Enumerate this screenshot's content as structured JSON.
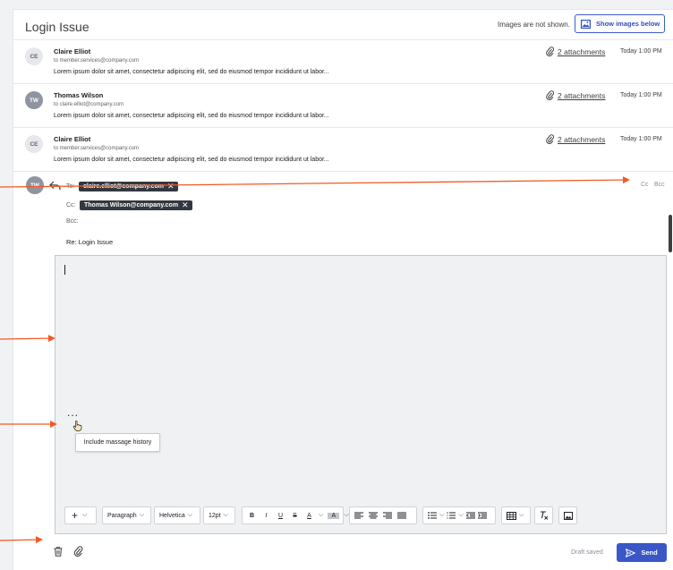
{
  "header": {
    "title": "Login Issue",
    "images_notice": "Images are not shown.",
    "show_images_button": "Show images below"
  },
  "messages": [
    {
      "initials": "CE",
      "sender": "Claire Elliot",
      "to": "to member.services@company.com",
      "preview": "Lorem ipsum dolor sit amet, consectetur adipiscing elit, sed do eiusmod tempor incididunt ut labor...",
      "attachments": "2 attachments",
      "time": "Today 1:00 PM",
      "avatar_style": "light"
    },
    {
      "initials": "TW",
      "sender": "Thomas Wilson",
      "to": "to claire.elliot@company.com",
      "preview": "Lorem ipsum dolor sit amet, consectetur adipiscing elit, sed do eiusmod tempor incididunt ut labor...",
      "attachments": "2 attachments",
      "time": "Today 1:00 PM",
      "avatar_style": "dark"
    },
    {
      "initials": "CE",
      "sender": "Claire Elliot",
      "to": "to member.services@company.com",
      "preview": "Lorem ipsum dolor sit amet, consectetur adipiscing elit, sed do eiusmod tempor incididunt ut labor...",
      "attachments": "2 attachments",
      "time": "Today 1:00 PM",
      "avatar_style": "light"
    }
  ],
  "compose": {
    "initials": "TW",
    "to_label": "To:",
    "to_chip": "claire.elliot@company.com",
    "cc_label": "Cc:",
    "cc_chip": "Thomas Wilson@company.com",
    "bcc_label": "Bcc:",
    "cc_link": "Cc",
    "bcc_link": "Bcc",
    "subject": "Re: Login Issue",
    "ellipsis": "...",
    "tooltip": "Include massage history",
    "toolbar": {
      "insert": "+",
      "paragraph": "Paragraph",
      "font": "Helvetica",
      "size": "12pt",
      "bold": "B",
      "italic": "I",
      "underline": "U",
      "strike": "S",
      "text_color": "A",
      "highlight": "A"
    },
    "draft_status": "Draft saved",
    "send_label": "Send"
  },
  "colors": {
    "accent": "#3a57c8",
    "chip_bg": "#33373f",
    "annotation_arrow": "#f15a24"
  },
  "icons": [
    "image-icon",
    "paperclip-icon",
    "reply-icon",
    "close-icon",
    "cursor-hand-icon",
    "trash-icon",
    "send-icon",
    "bullet-list-icon",
    "numbered-list-icon",
    "outdent-icon",
    "indent-icon",
    "table-icon",
    "clear-format-icon",
    "insert-image-icon",
    "chevron-down-icon"
  ]
}
